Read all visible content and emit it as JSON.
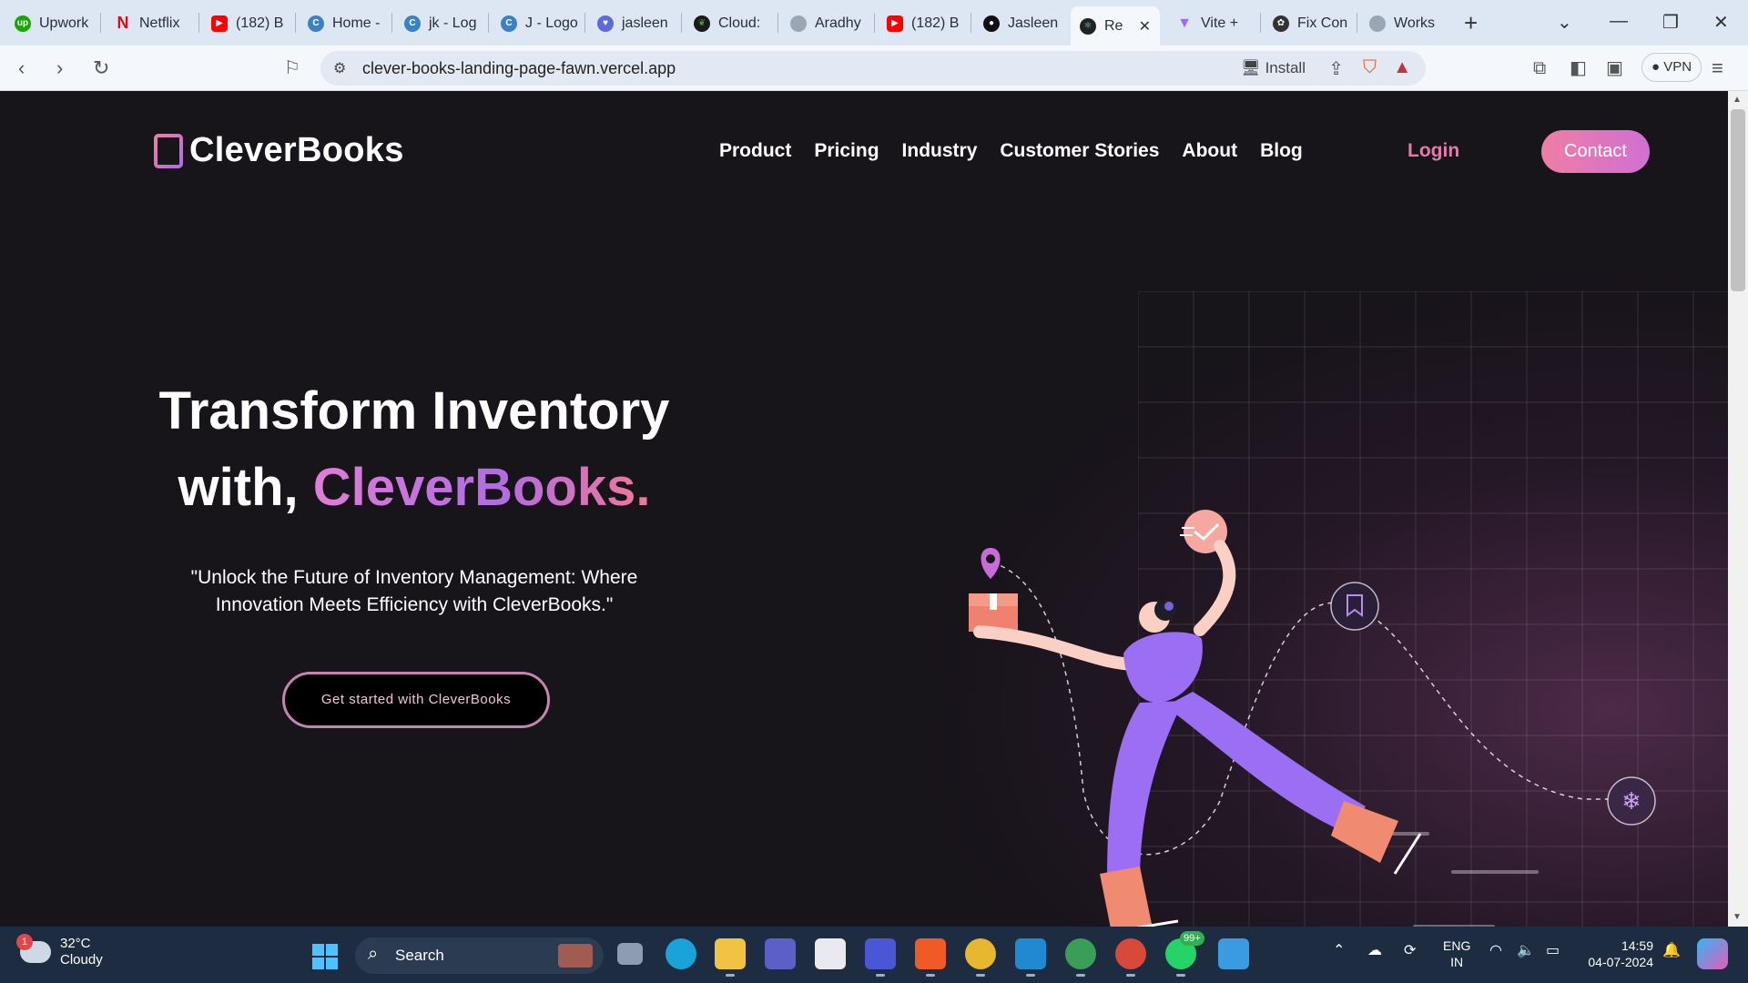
{
  "browser": {
    "tabs": [
      {
        "label": "Upwork",
        "icon": "upwork-icon",
        "color": "#14a800"
      },
      {
        "label": "Netflix",
        "icon": "netflix-icon",
        "color": "#e50914"
      },
      {
        "label": "(182) B",
        "icon": "youtube-icon",
        "color": "#ff0000"
      },
      {
        "label": "Home -",
        "icon": "canva-icon",
        "color": "#3b82c4"
      },
      {
        "label": "jk - Log",
        "icon": "canva-icon",
        "color": "#3b82c4"
      },
      {
        "label": "J - Logo",
        "icon": "canva-icon",
        "color": "#3b82c4"
      },
      {
        "label": "jasleen",
        "icon": "heart-icon",
        "color": "#5b6bd8"
      },
      {
        "label": "Cloud:",
        "icon": "mongodb-icon",
        "color": "#1a1a1a"
      },
      {
        "label": "Aradhy",
        "icon": "avatar-icon",
        "color": "#9aa6b4"
      },
      {
        "label": "(182) B",
        "icon": "youtube-icon",
        "color": "#ff0000"
      },
      {
        "label": "Jasleen",
        "icon": "github-icon",
        "color": "#111111"
      },
      {
        "label": "Re",
        "icon": "react-icon",
        "color": "#222222",
        "active": true
      },
      {
        "label": "Vite +",
        "icon": "vite-icon",
        "color": "#a566ff"
      },
      {
        "label": "Fix Con",
        "icon": "openai-icon",
        "color": "#333333"
      },
      {
        "label": "Works",
        "icon": "avatar-icon",
        "color": "#9aa6b4"
      }
    ],
    "url": "clever-books-landing-page-fawn.vercel.app",
    "install_label": "Install",
    "vpn_label": "VPN"
  },
  "page": {
    "logo_text": "CleverBooks",
    "nav": [
      "Product",
      "Pricing",
      "Industry",
      "Customer Stories",
      "About",
      "Blog"
    ],
    "login_label": "Login",
    "contact_label": "Contact",
    "headline_line1": "Transform Inventory",
    "headline_prefix": "with, ",
    "headline_brand": "CleverBooks.",
    "tagline": "\"Unlock the Future of Inventory Management: Where Innovation Meets Efficiency with CleverBooks.\"",
    "cta_label": "Get started with CleverBooks",
    "colors": {
      "accent_pink": "#ef7ea4",
      "accent_purple": "#b26be3",
      "background": "#17141a"
    }
  },
  "taskbar": {
    "weather_temp": "32°C",
    "weather_desc": "Cloudy",
    "weather_badge": "1",
    "search_label": "Search",
    "whatsapp_badge": "99+",
    "lang_line1": "ENG",
    "lang_line2": "IN",
    "time": "14:59",
    "date": "04-07-2024"
  }
}
